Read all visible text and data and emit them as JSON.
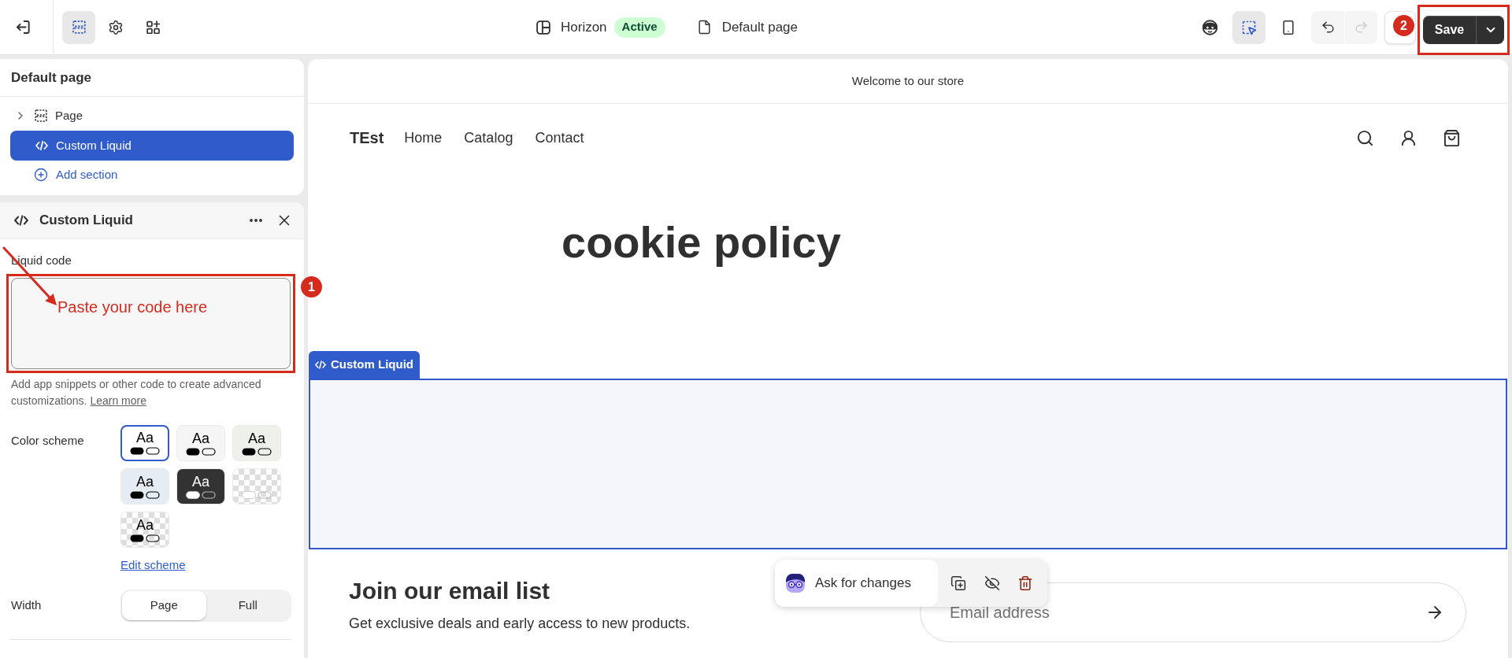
{
  "top_bar": {
    "tools": [
      {
        "selected": true
      },
      {
        "selected": false
      },
      {
        "selected": false
      }
    ],
    "theme": {
      "name": "Horizon",
      "status": "Active"
    },
    "page": "Default page",
    "preview_tools": [
      {
        "selected": false
      },
      {
        "selected": true
      },
      {
        "selected": false
      }
    ],
    "history": [
      {
        "disabled": false
      },
      {
        "disabled": true
      }
    ],
    "save": "Save"
  },
  "sidebar": {
    "title": "Default page",
    "items": [
      {
        "label": "Page",
        "kind": "group",
        "expanded": false,
        "selected": false
      },
      {
        "label": "Custom Liquid",
        "kind": "section",
        "selected": true
      }
    ],
    "add": "Add section"
  },
  "settings": {
    "title": "Custom Liquid",
    "code_label": "Liquid code",
    "help": "Add app snippets or other code to create advanced customizations.",
    "help_link": "Learn more",
    "scheme_label": "Color scheme",
    "schemes": [
      {
        "label": "Aa",
        "kind": "solid",
        "color": "#ffffff",
        "inverted": false,
        "selected": true
      },
      {
        "label": "Aa",
        "kind": "solid",
        "color": "#f5f5f5",
        "inverted": false,
        "selected": false
      },
      {
        "label": "Aa",
        "kind": "solid",
        "color": "#eef0ea",
        "inverted": false,
        "selected": false
      },
      {
        "label": "Aa",
        "kind": "solid",
        "color": "#e6ecf3",
        "inverted": false,
        "selected": false
      },
      {
        "label": "Aa",
        "kind": "solid",
        "color": "#333333",
        "inverted": true,
        "selected": false
      },
      {
        "kind": "checker",
        "inverted": true,
        "selected": false
      },
      {
        "label": "Aa",
        "kind": "checker",
        "inverted": false,
        "selected": false
      }
    ],
    "scheme_link": "Edit scheme",
    "width_label": "Width",
    "width_options": [
      {
        "label": "Page",
        "selected": true
      },
      {
        "label": "Full",
        "selected": false
      }
    ]
  },
  "preview": {
    "announcement": "Welcome to our store",
    "logo": "TEst",
    "nav": [
      "Home",
      "Catalog",
      "Contact"
    ],
    "heading": "cookie policy",
    "section_tag": "Custom Liquid",
    "newsletter": {
      "title": "Join our email list",
      "text": "Get exclusive deals and early access to new products.",
      "placeholder": "Email address"
    }
  },
  "section_toolbar": {
    "prompt": "Ask for changes"
  },
  "annotations": {
    "markers": [
      "1",
      "2"
    ],
    "note": "Paste your code here"
  }
}
